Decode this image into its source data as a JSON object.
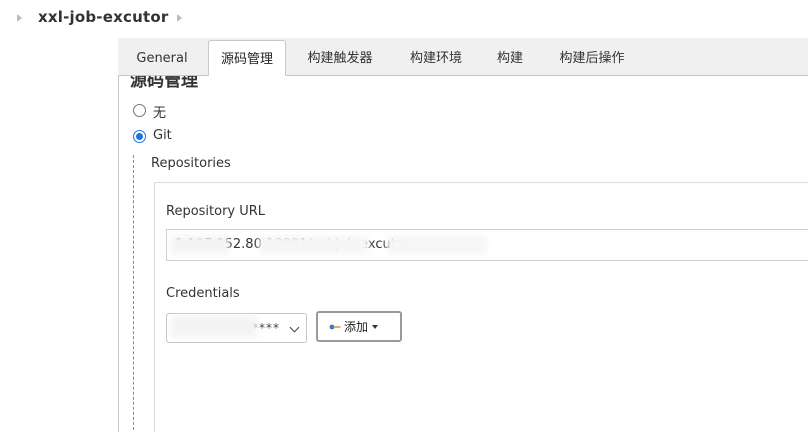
{
  "breadcrumb": {
    "job_name": "xxl-job-excutor"
  },
  "tabs": [
    {
      "label": "General",
      "active": false
    },
    {
      "label": "源码管理",
      "active": true
    },
    {
      "label": "构建触发器",
      "active": false
    },
    {
      "label": "构建环境",
      "active": false
    },
    {
      "label": "构建",
      "active": false
    },
    {
      "label": "构建后操作",
      "active": false
    }
  ],
  "scm": {
    "cut_heading": "源码管理",
    "options": [
      {
        "label": "无",
        "selected": false
      },
      {
        "label": "Git",
        "selected": true
      }
    ],
    "repositories_title": "Repositories",
    "repository_url_label": "Repository URL",
    "repository_url_value": "1.197.152.80:10001/xxl-job-excutor",
    "credentials_label": "Credentials",
    "credentials_value": "*****",
    "add_button_label": "添加"
  },
  "colors": {
    "accent": "#1a73e8",
    "tabbar_bg": "#f0f0f0",
    "border": "#c8c8c8"
  },
  "icons": {
    "add_button_icon": "key-icon",
    "breadcrumb_separator": "chevron-right-icon"
  }
}
